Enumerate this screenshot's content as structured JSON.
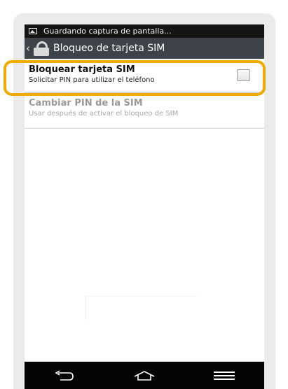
{
  "status_bar": {
    "notification_icon": "image-icon",
    "text": "Guardando captura de pantalla..."
  },
  "action_bar": {
    "back_icon": "chevron-left-icon",
    "app_icon": "lock-icon",
    "title": "Bloqueo de tarjeta SIM"
  },
  "settings": [
    {
      "title": "Bloquear tarjeta SIM",
      "subtitle": "Solicitar PIN para utilizar el teléfono",
      "checked": false,
      "enabled": true
    },
    {
      "title": "Cambiar PIN de la SIM",
      "subtitle": "Usar después de activar el bloqueo de SIM",
      "enabled": false
    }
  ],
  "nav_bar": {
    "buttons": [
      "back-icon",
      "home-icon",
      "menu-icon"
    ]
  },
  "colors": {
    "highlight": "#f2a900",
    "action_bar": "#3e4349",
    "status_bar": "#141414",
    "nav_bar": "#050505",
    "disabled_text": "#9a9a9a"
  }
}
